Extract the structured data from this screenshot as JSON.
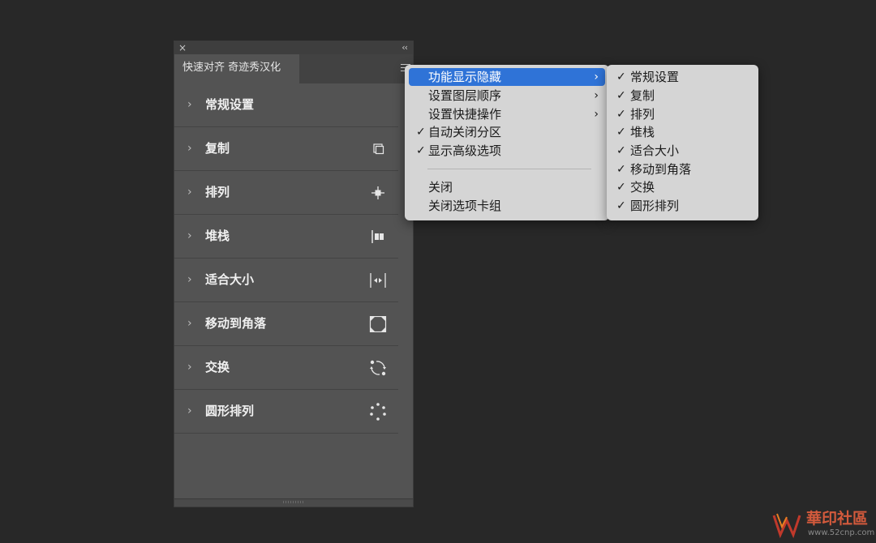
{
  "panel": {
    "close_glyph": "×",
    "collapse_glyph": "‹‹",
    "tab_label": "快速对齐 奇迹秀汉化",
    "rows": [
      {
        "label": "常规设置",
        "icon": "none"
      },
      {
        "label": "复制",
        "icon": "duplicate-icon"
      },
      {
        "label": "排列",
        "icon": "align-center-icon"
      },
      {
        "label": "堆栈",
        "icon": "stack-icon"
      },
      {
        "label": "适合大小",
        "icon": "fit-size-icon"
      },
      {
        "label": "移动到角落",
        "icon": "move-to-corner-icon"
      },
      {
        "label": "交换",
        "icon": "swap-icon"
      },
      {
        "label": "圆形排列",
        "icon": "circular-arrange-icon"
      }
    ],
    "chevron_glyph": "›"
  },
  "flyout_menu": {
    "items": [
      {
        "label": "功能显示隐藏",
        "checked": false,
        "submenu": true,
        "active": true
      },
      {
        "label": "设置图层顺序",
        "checked": false,
        "submenu": true,
        "active": false
      },
      {
        "label": "设置快捷操作",
        "checked": false,
        "submenu": true,
        "active": false
      },
      {
        "label": "自动关闭分区",
        "checked": true,
        "submenu": false,
        "active": false
      },
      {
        "label": "显示高级选项",
        "checked": true,
        "submenu": false,
        "active": false
      },
      {
        "label": "关闭",
        "checked": false,
        "submenu": false,
        "active": false
      },
      {
        "label": "关闭选项卡组",
        "checked": false,
        "submenu": false,
        "active": false
      }
    ],
    "check_glyph": "✓",
    "arrow_glyph": "›"
  },
  "submenu": {
    "items": [
      {
        "label": "常规设置",
        "checked": true
      },
      {
        "label": "复制",
        "checked": true
      },
      {
        "label": "排列",
        "checked": true
      },
      {
        "label": "堆栈",
        "checked": true
      },
      {
        "label": "适合大小",
        "checked": true
      },
      {
        "label": "移动到角落",
        "checked": true
      },
      {
        "label": "交换",
        "checked": true
      },
      {
        "label": "圆形排列",
        "checked": true
      }
    ]
  },
  "watermark": {
    "text": "華印社區",
    "url": "www.52cnp.com"
  },
  "colors": {
    "panel_bg": "#535353",
    "menu_bg": "#d5d5d5",
    "menu_active": "#2f73d7",
    "page_bg": "#282828"
  }
}
